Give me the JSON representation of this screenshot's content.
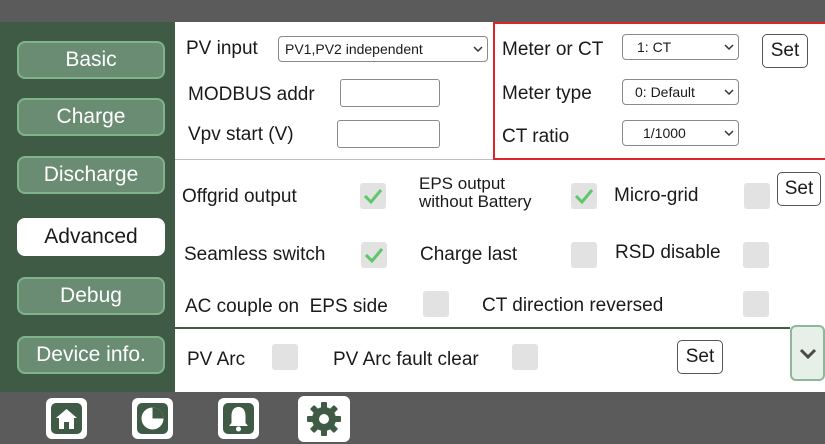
{
  "sidebar": {
    "items": [
      {
        "label": "Basic"
      },
      {
        "label": "Charge"
      },
      {
        "label": "Discharge"
      },
      {
        "label": "Advanced"
      },
      {
        "label": "Debug"
      },
      {
        "label": "Device info."
      }
    ],
    "active": "Advanced"
  },
  "pv": {
    "pv_input_label": "PV input",
    "pv_input_value": "PV1,PV2 independent",
    "modbus_label": "MODBUS addr",
    "modbus_value": "",
    "vpv_label": "Vpv start (V)",
    "vpv_value": ""
  },
  "meter": {
    "meter_or_ct_label": "Meter or CT",
    "meter_or_ct_value": "1: CT",
    "meter_type_label": "Meter type",
    "meter_type_value": "0: Default",
    "ct_ratio_label": "CT ratio",
    "ct_ratio_value": "1/1000",
    "set_label": "Set"
  },
  "options": {
    "offgrid_output": {
      "label": "Offgrid output",
      "checked": true
    },
    "eps_output_line1": "EPS output",
    "eps_output_line2": "without Battery",
    "eps_output_checked": true,
    "micro_grid": {
      "label": "Micro-grid",
      "checked": false
    },
    "set_label": "Set",
    "seamless_switch": {
      "label": "Seamless switch",
      "checked": true
    },
    "charge_last": {
      "label": "Charge last",
      "checked": false
    },
    "rsd_disable": {
      "label": "RSD disable",
      "checked": false
    },
    "ac_couple": {
      "label": "AC couple on  EPS side",
      "checked": false
    },
    "ct_direction": {
      "label": "CT direction reversed",
      "checked": false
    }
  },
  "arc": {
    "pv_arc": {
      "label": "PV Arc",
      "checked": false
    },
    "pv_arc_fault_clear": {
      "label": "PV Arc fault clear",
      "checked": false
    },
    "set_label": "Set"
  },
  "bottom_tabs": [
    {
      "icon": "home-icon"
    },
    {
      "icon": "pie-chart-icon"
    },
    {
      "icon": "bell-icon"
    },
    {
      "icon": "gear-icon",
      "active": true
    }
  ],
  "colors": {
    "sidebar_bg": "#3f5b45",
    "nav_button": "#6a8c72",
    "check_green": "#5cc86a",
    "highlight_red": "#d9252b",
    "bar_gray": "#5b5b5b"
  }
}
